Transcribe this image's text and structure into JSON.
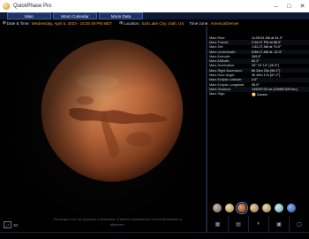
{
  "window": {
    "title": "QuickPhase Pro",
    "buttons": [
      "–",
      "□",
      "✕"
    ]
  },
  "nav": {
    "tabs": [
      "Main",
      "Moon Calendar",
      "Moon Data"
    ]
  },
  "info": {
    "date_label": "Date & Time:",
    "date_value": "Wednesday, April 5, 2023 - 10:25:49 PM MDT",
    "location_label": "Location:",
    "location_value": "Salt Lake City, Utah, US",
    "timezone_label": "Time zone:",
    "timezone_value": "America/Denver"
  },
  "stage": {
    "disclaimer": "This image is for the purposes of illustration. It doesn't represent the current illumination or alignment.",
    "zoom_label": "3D"
  },
  "mars_data": [
    {
      "k": "Mars Rise:",
      "v": "11:05:51 AM at 51.3°"
    },
    {
      "k": "Mars Transit:",
      "v": "2:26:47 PM at 68.0°"
    },
    {
      "k": "Mars Set:",
      "v": "1:52:27 AM at 74.0°"
    },
    {
      "k": "Mars Underneath:",
      "v": "6:58:17 AM at -21.9°"
    },
    {
      "k": "Mars Azimuth:",
      "v": "269.8°"
    },
    {
      "k": "Mars Altitude:",
      "v": "62.2°"
    },
    {
      "k": "Mars Declination:",
      "v": "25° 19' 14\" (25.3°)"
    },
    {
      "k": "Mars Right Ascension:",
      "v": "6h 24m 23s (96.1°)"
    },
    {
      "k": "Mars Hour Angle:",
      "v": "3h 49m 17s (57.2°)"
    },
    {
      "k": "Mars Ecliptic Latitude:",
      "v": "2.0°"
    },
    {
      "k": "Mars Ecliptic Longitude:",
      "v": "95.5°"
    },
    {
      "k": "Mars Distance:",
      "v": "139057/33 mi (225897425 km)"
    },
    {
      "k": "Mars Sign:",
      "v": "♋ Cancer"
    }
  ],
  "planets": [
    "mercury",
    "venus",
    "mars",
    "jupiter",
    "saturn",
    "uranus",
    "neptune"
  ],
  "footer_icons": [
    "grid-icon",
    "list-icon",
    "moon-icon",
    "calendar-icon",
    "info-icon"
  ],
  "colors": {
    "accent": "#e3a533",
    "nav": "#1d3365"
  }
}
